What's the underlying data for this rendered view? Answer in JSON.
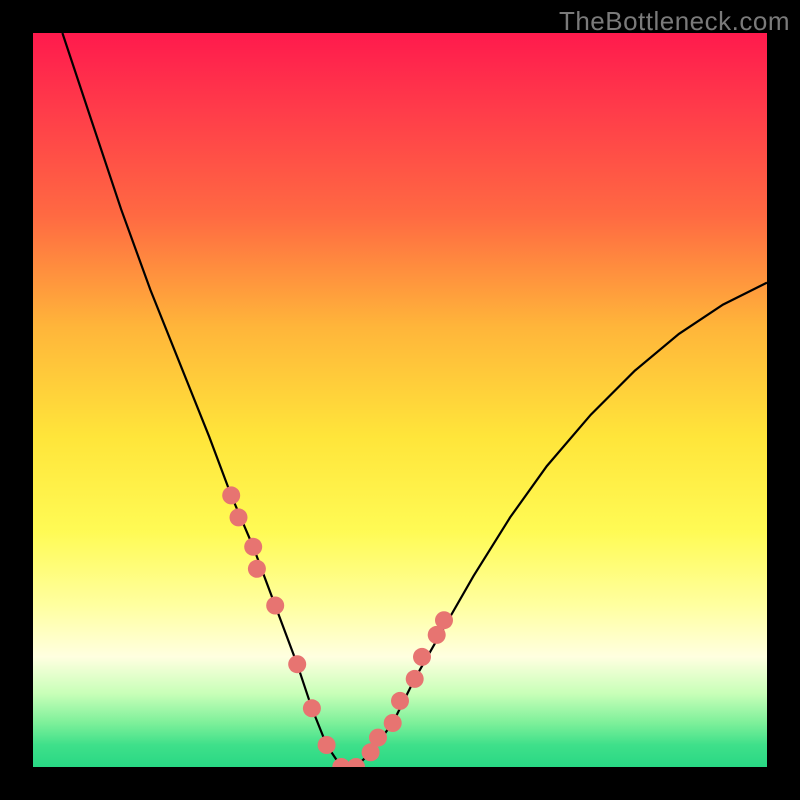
{
  "watermark": "TheBottleneck.com",
  "chart_data": {
    "type": "line",
    "title": "",
    "xlabel": "",
    "ylabel": "",
    "xlim": [
      0,
      100
    ],
    "ylim": [
      0,
      100
    ],
    "background_gradient": {
      "top_color": "#ff1a4d",
      "bottom_color": "#28d884",
      "description": "Vertical gradient red→orange→yellow→green representing bottleneck severity (red=high, green=low)"
    },
    "series": [
      {
        "name": "bottleneck-curve",
        "description": "V-shaped bottleneck percentage curve; minimum near x≈42 at y≈0",
        "x": [
          4,
          8,
          12,
          16,
          20,
          24,
          27,
          30,
          33,
          36,
          38,
          40,
          42,
          44,
          46,
          49,
          52,
          56,
          60,
          65,
          70,
          76,
          82,
          88,
          94,
          100
        ],
        "y": [
          100,
          88,
          76,
          65,
          55,
          45,
          37,
          30,
          22,
          14,
          8,
          3,
          0,
          0,
          2,
          6,
          12,
          19,
          26,
          34,
          41,
          48,
          54,
          59,
          63,
          66
        ]
      },
      {
        "name": "highlighted-points",
        "description": "Salmon dots marking sample configurations along the curve near the minimum",
        "x": [
          27,
          28,
          30,
          30.5,
          33,
          36,
          38,
          40,
          42,
          44,
          46,
          47,
          49,
          50,
          52,
          53,
          55,
          56
        ],
        "y": [
          37,
          34,
          30,
          27,
          22,
          14,
          8,
          3,
          0,
          0,
          2,
          4,
          6,
          9,
          12,
          15,
          18,
          20
        ]
      }
    ]
  }
}
